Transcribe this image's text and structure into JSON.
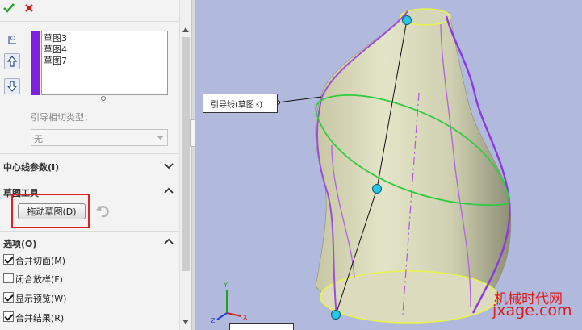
{
  "panel": {
    "profiles_list": [
      "草图3",
      "草图4",
      "草图7"
    ],
    "tangency_label": "引导相切类型：",
    "tangency_value": "无",
    "sections": {
      "centerline": "中心线参数(I)",
      "sketch_tools": "草图工具",
      "options": "选项(O)"
    },
    "drag_sketch_button": "拖动草图(D)",
    "options": [
      {
        "label": "合并切面(M)",
        "checked": true
      },
      {
        "label": "闭合放样(F)",
        "checked": false
      },
      {
        "label": "显示预览(W)",
        "checked": true
      },
      {
        "label": "合并结果(R)",
        "checked": true
      }
    ]
  },
  "viewport": {
    "callout_label": "引导线(草图3)",
    "watermark_cn": "机械时代网",
    "watermark_url": "jxage.com"
  },
  "colors": {
    "accent_check": "#29a329",
    "accent_close": "#d41818",
    "profile_bar": "#7f1fe0",
    "viewport_bg": "#b1b9dd",
    "highlight_box": "#e32020"
  }
}
